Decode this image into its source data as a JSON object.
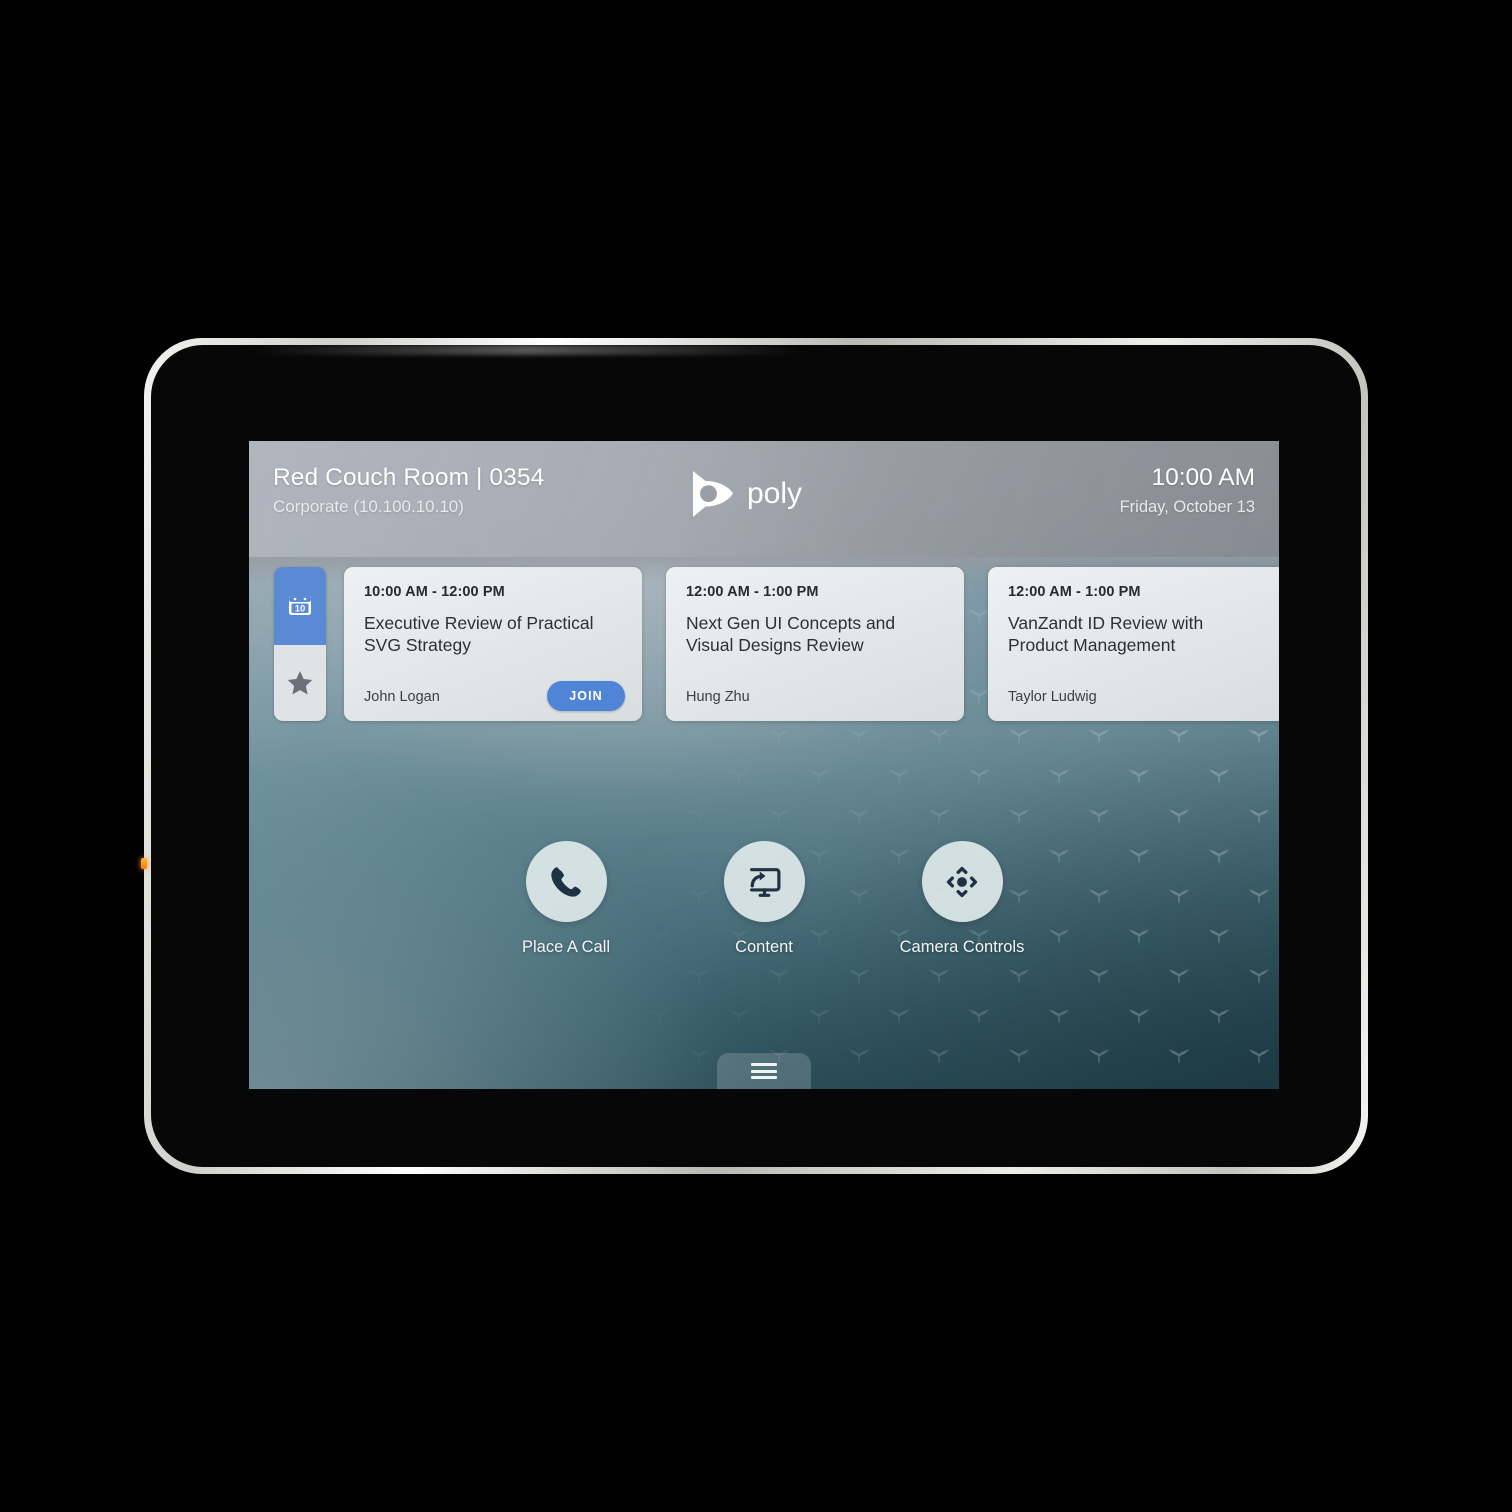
{
  "header": {
    "room_name": "Red Couch Room | 0354",
    "room_sub": "Corporate (10.100.10.10)",
    "brand": "poly",
    "brand_icon": "poly-propeller-logo-icon",
    "time": "10:00 AM",
    "date": "Friday, October 13"
  },
  "rail": {
    "calendar_icon": "calendar-icon",
    "calendar_day": "10",
    "favorites_icon": "star-icon"
  },
  "agenda": [
    {
      "time": "10:00 AM - 12:00 PM",
      "title": "Executive Review of Practical SVG Strategy",
      "organizer": "John Logan",
      "join_label": "JOIN",
      "has_join": true
    },
    {
      "time": "12:00 AM - 1:00 PM",
      "title": "Next Gen UI Concepts and Visual Designs Review",
      "organizer": "Hung Zhu",
      "join_label": "",
      "has_join": false
    },
    {
      "time": "12:00 AM - 1:00 PM",
      "title": "VanZandt ID Review with Product Management",
      "organizer": "Taylor Ludwig",
      "join_label": "",
      "has_join": false
    }
  ],
  "actions": [
    {
      "label": "Place A Call",
      "icon": "phone-handset-icon"
    },
    {
      "label": "Content",
      "icon": "screen-share-icon"
    },
    {
      "label": "Camera Controls",
      "icon": "camera-pan-tilt-icon"
    }
  ],
  "bottom": {
    "menu_icon": "hamburger-menu-icon"
  },
  "colors": {
    "accent_blue": "#4f84d6",
    "calendar_blue": "#5a8ad4",
    "icon_navy": "#1f3244",
    "card_bg": "#e9ecee",
    "favorite_gray": "#6a7077",
    "led_amber": "#ff9020"
  }
}
